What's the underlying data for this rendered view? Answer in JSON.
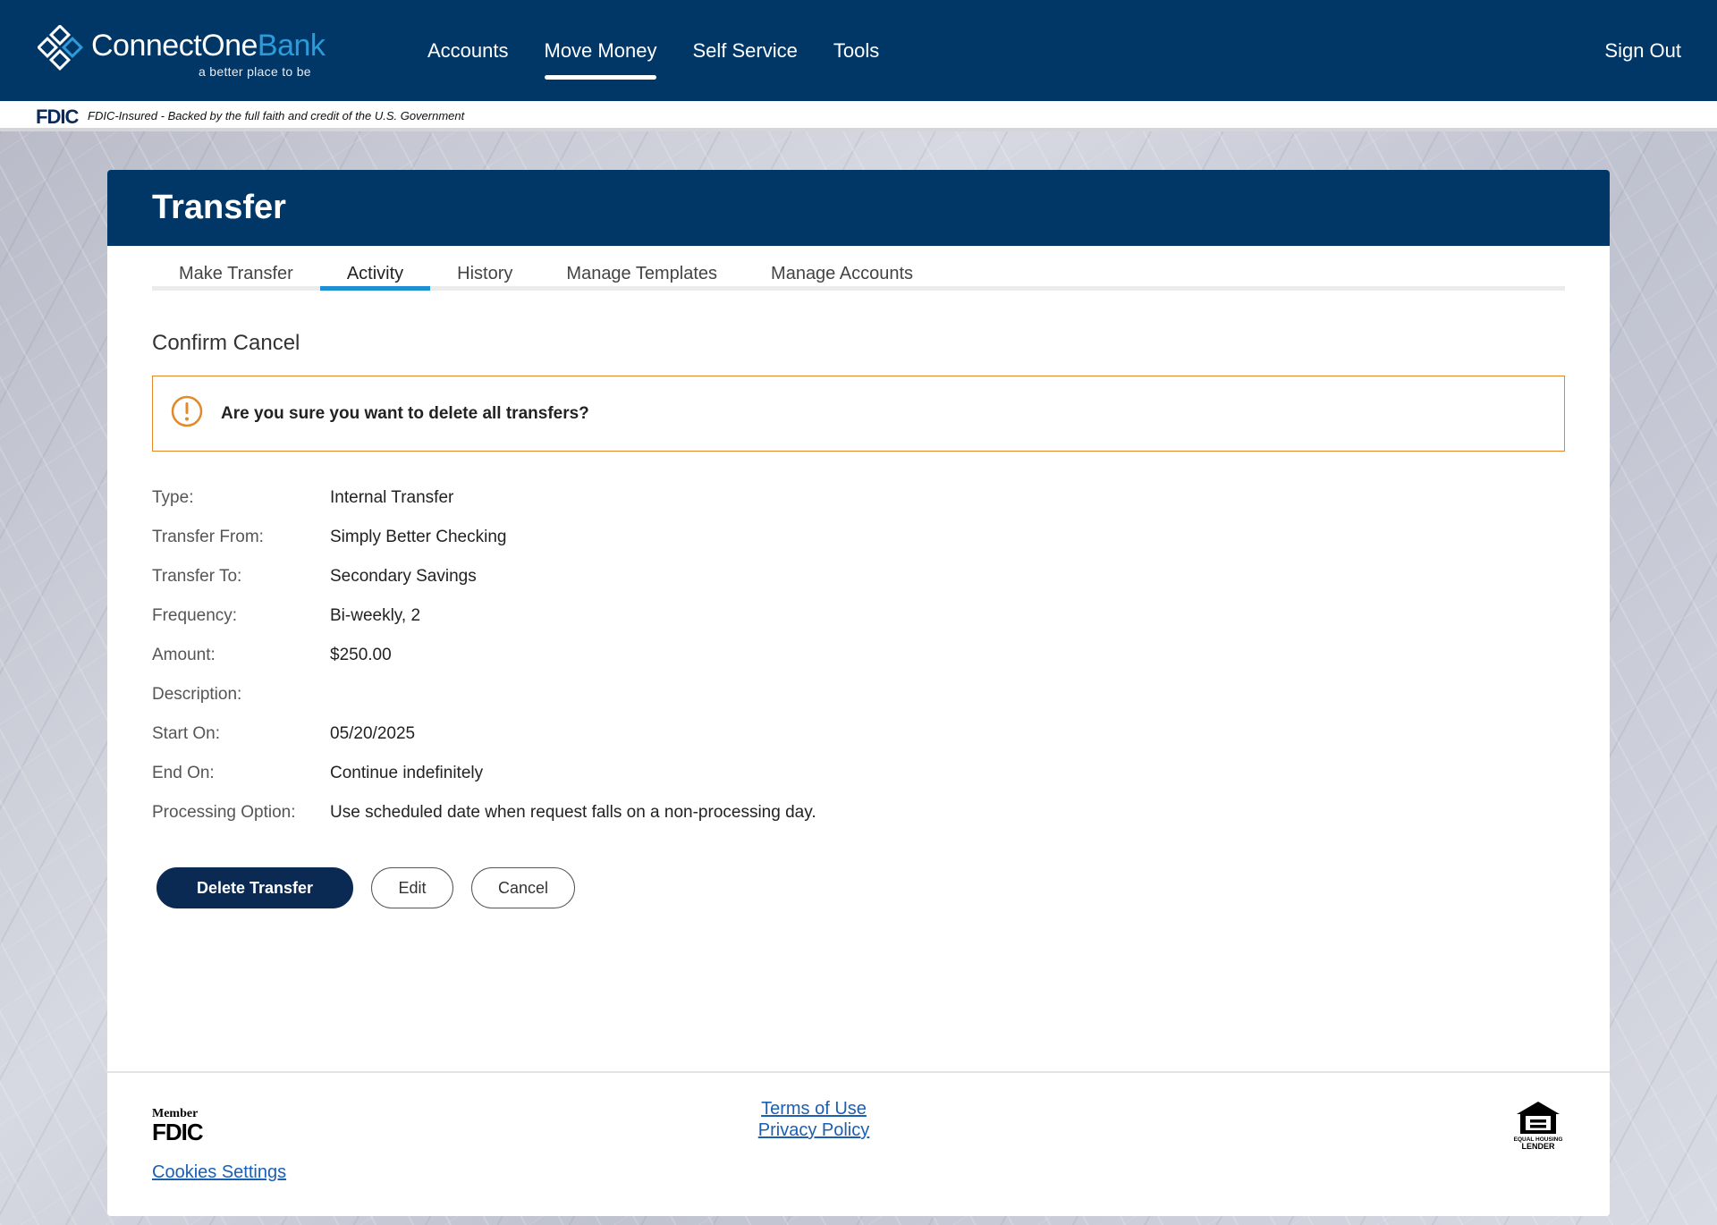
{
  "brand": {
    "name_part1": "ConnectOne",
    "name_part2": "Bank",
    "tagline": "a better place to be"
  },
  "nav": {
    "items": [
      {
        "label": "Accounts",
        "active": false
      },
      {
        "label": "Move Money",
        "active": true
      },
      {
        "label": "Self Service",
        "active": false
      },
      {
        "label": "Tools",
        "active": false
      }
    ],
    "signout": "Sign Out"
  },
  "fdic_banner": {
    "logo": "FDIC",
    "text": "FDIC-Insured - Backed by the full faith and credit of the U.S. Government"
  },
  "page": {
    "title": "Transfer",
    "tabs": [
      {
        "label": "Make Transfer",
        "active": false
      },
      {
        "label": "Activity",
        "active": true
      },
      {
        "label": "History",
        "active": false
      },
      {
        "label": "Manage Templates",
        "active": false
      },
      {
        "label": "Manage Accounts",
        "active": false
      }
    ],
    "section_title": "Confirm Cancel",
    "alert": {
      "icon": "exclamation-circle-icon",
      "text": "Are you sure you want to delete all transfers?"
    },
    "details": [
      {
        "label": "Type:",
        "value": "Internal Transfer"
      },
      {
        "label": "Transfer From:",
        "value": "Simply Better Checking"
      },
      {
        "label": "Transfer To:",
        "value": "Secondary Savings"
      },
      {
        "label": "Frequency:",
        "value": "Bi-weekly, 2"
      },
      {
        "label": "Amount:",
        "value": "$250.00"
      },
      {
        "label": "Description:",
        "value": ""
      },
      {
        "label": "Start On:",
        "value": "05/20/2025"
      },
      {
        "label": "End On:",
        "value": "Continue indefinitely"
      },
      {
        "label": "Processing Option:",
        "value": "Use scheduled date when request falls on a non-processing day."
      }
    ],
    "buttons": {
      "delete": "Delete Transfer",
      "edit": "Edit",
      "cancel": "Cancel"
    }
  },
  "footer": {
    "member_fdic_top": "Member",
    "member_fdic_bottom": "FDIC",
    "cookies": "Cookies Settings",
    "terms": "Terms of Use",
    "privacy": "Privacy Policy",
    "equal_housing": "EQUAL HOUSING LENDER"
  },
  "colors": {
    "navy": "#003767",
    "accent_blue": "#1e8fd3",
    "alert_orange": "#e2892c",
    "button_navy": "#0a2a54",
    "link_blue": "#1a5fb4"
  }
}
